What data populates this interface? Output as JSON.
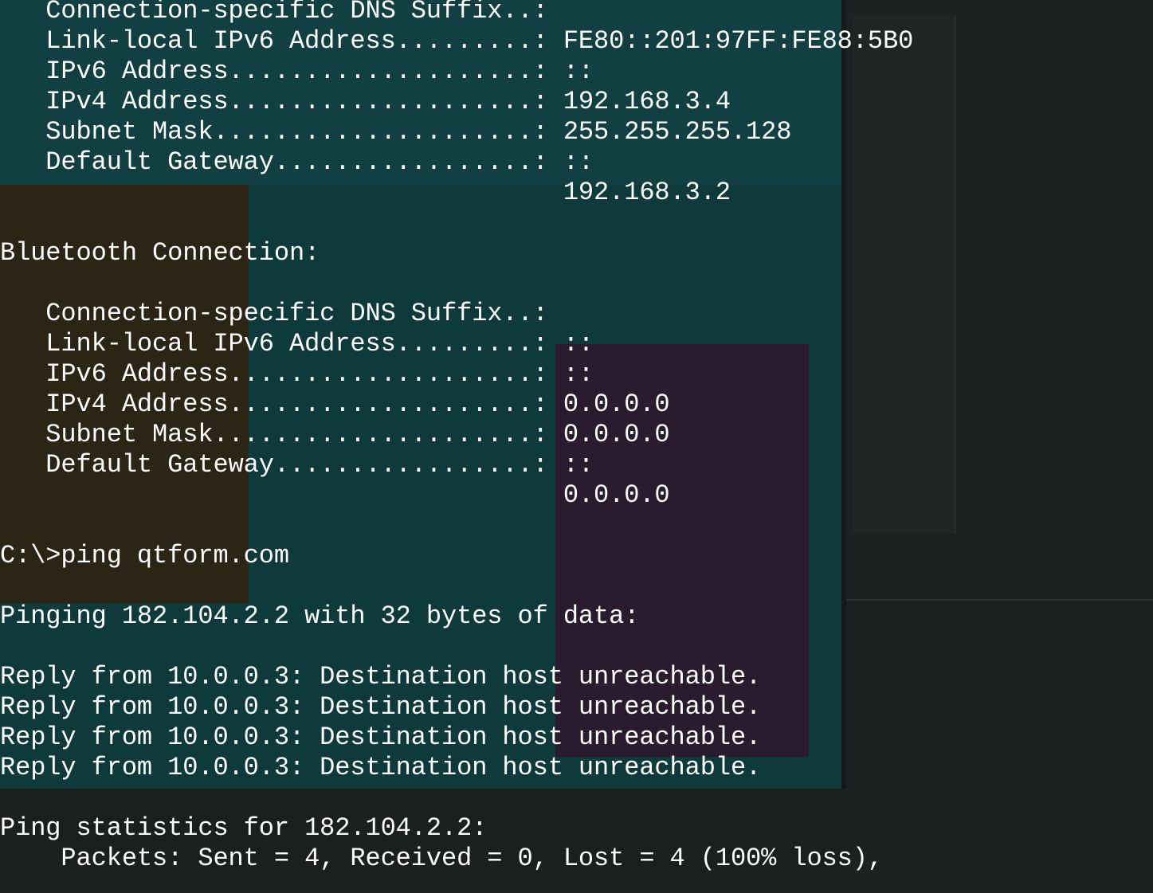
{
  "terminal": {
    "lines": [
      "   Connection-specific DNS Suffix..:",
      "   Link-local IPv6 Address.........: FE80::201:97FF:FE88:5B0",
      "   IPv6 Address....................: ::",
      "   IPv4 Address....................: 192.168.3.4",
      "   Subnet Mask.....................: 255.255.255.128",
      "   Default Gateway.................: ::",
      "                                     192.168.3.2",
      "",
      "Bluetooth Connection:",
      "",
      "   Connection-specific DNS Suffix..:",
      "   Link-local IPv6 Address.........: ::",
      "   IPv6 Address....................: ::",
      "   IPv4 Address....................: 0.0.0.0",
      "   Subnet Mask.....................: 0.0.0.0",
      "   Default Gateway.................: ::",
      "                                     0.0.0.0",
      "",
      "C:\\>ping qtform.com",
      "",
      "Pinging 182.104.2.2 with 32 bytes of data:",
      "",
      "Reply from 10.0.0.3: Destination host unreachable.",
      "Reply from 10.0.0.3: Destination host unreachable.",
      "Reply from 10.0.0.3: Destination host unreachable.",
      "Reply from 10.0.0.3: Destination host unreachable.",
      "",
      "Ping statistics for 182.104.2.2:",
      "    Packets: Sent = 4, Received = 0, Lost = 4 (100% loss),"
    ]
  },
  "colors": {
    "text": "#ffffff",
    "background": "#1b1e1f"
  }
}
